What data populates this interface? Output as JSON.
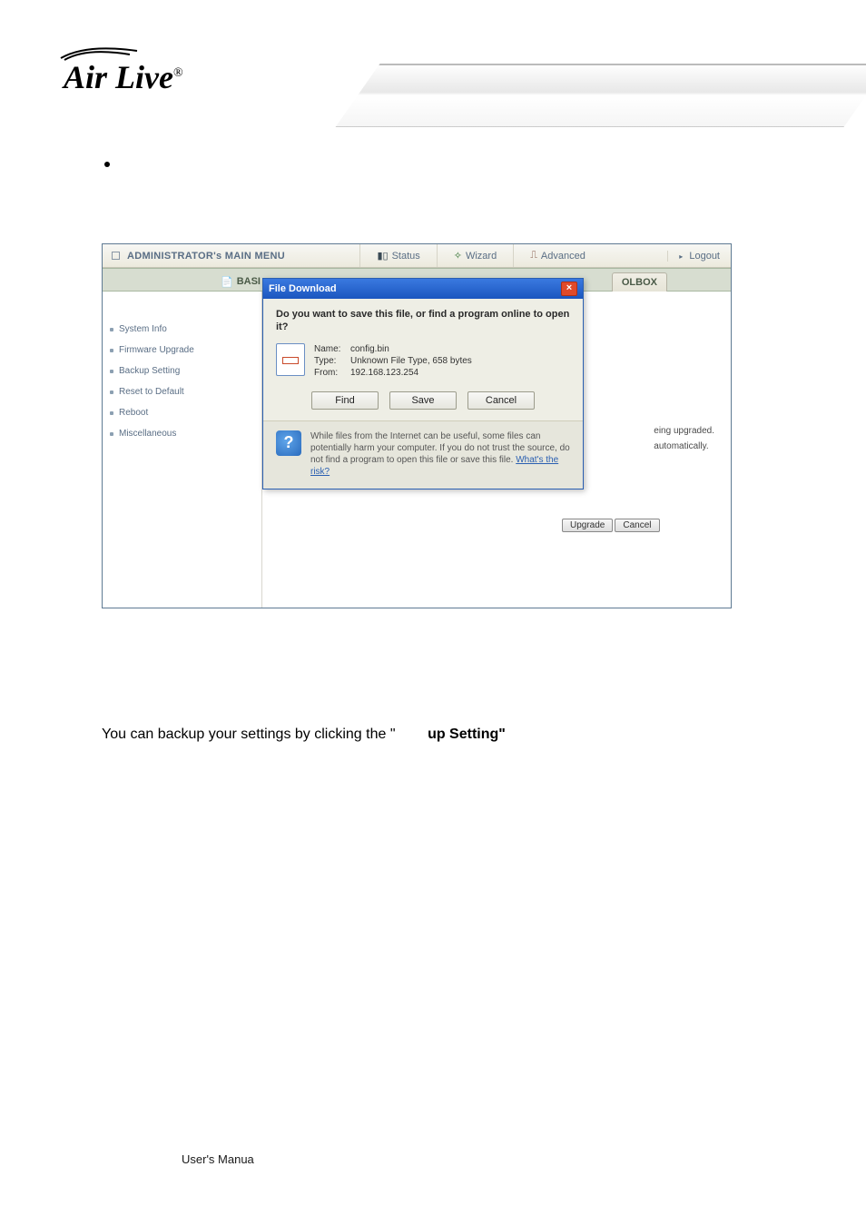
{
  "logo": {
    "text": "Air Live",
    "registered": "®"
  },
  "top": {
    "admin_menu": "ADMINISTRATOR's MAIN MENU",
    "status": "Status",
    "wizard": "Wizard",
    "advanced": "Advanced",
    "logout": "Logout"
  },
  "tabs": {
    "basic": "BASI",
    "toolbox_partial": "OLBOX"
  },
  "sidebar": {
    "items": [
      {
        "label": "System Info"
      },
      {
        "label": "Firmware Upgrade"
      },
      {
        "label": "Backup Setting"
      },
      {
        "label": "Reset to Default"
      },
      {
        "label": "Reboot"
      },
      {
        "label": "Miscellaneous"
      }
    ]
  },
  "dialog": {
    "title": "File Download",
    "question": "Do you want to save this file, or find a program online to open it?",
    "name_label": "Name:",
    "name": "config.bin",
    "type_label": "Type:",
    "type": "Unknown File Type, 658 bytes",
    "from_label": "From:",
    "from": "192.168.123.254",
    "find": "Find",
    "save": "Save",
    "cancel": "Cancel",
    "warn": "While files from the Internet can be useful, some files can potentially harm your computer. If you do not trust the source, do not find a program to open this file or save this file.",
    "warn_link": "What's the risk?"
  },
  "content": {
    "upgraded": "eing upgraded.",
    "auto": "automatically.",
    "upgrade_btn": "Upgrade",
    "cancel_btn": "Cancel"
  },
  "body_line_a": "You can backup your settings by clicking the \"",
  "body_line_b": "up Setting\"",
  "footer": "User's Manua"
}
